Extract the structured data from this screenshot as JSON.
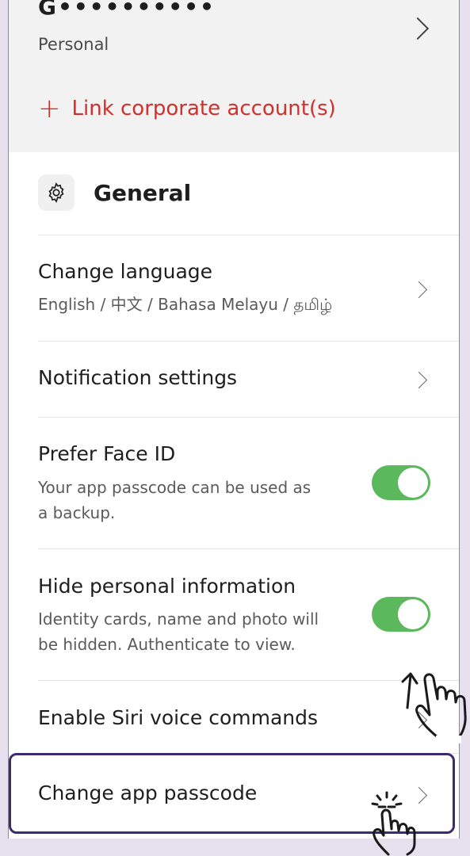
{
  "account": {
    "name": "G••••••••••",
    "type": "Personal",
    "link_corporate": "Link corporate account(s)"
  },
  "general": {
    "title": "General",
    "items": [
      {
        "title": "Change language",
        "subtitle": "English / 中文 / Bahasa Melayu / தமிழ்",
        "control": "chevron"
      },
      {
        "title": "Notification settings",
        "control": "chevron"
      },
      {
        "title": "Prefer Face ID",
        "subtitle_line1": "Your app passcode can be used as",
        "subtitle_line2": "a backup.",
        "control": "toggle",
        "on": true
      },
      {
        "title": "Hide personal information",
        "subtitle_line1": "Identity cards, name and photo will",
        "subtitle_line2": "be hidden. Authenticate to view.",
        "control": "toggle",
        "on": true
      },
      {
        "title": "Enable Siri voice commands",
        "control": "chevron"
      },
      {
        "title": "Change app passcode",
        "control": "chevron",
        "highlighted": true
      }
    ]
  },
  "colors": {
    "accent_red": "#d0312d",
    "toggle_green": "#5cb85c",
    "highlight_border": "#3b2b73",
    "page_background": "#e6e0ef"
  },
  "icons": [
    "chevron-right-icon",
    "plus-icon",
    "gear-icon",
    "scroll-hand-icon",
    "tap-hand-icon"
  ]
}
